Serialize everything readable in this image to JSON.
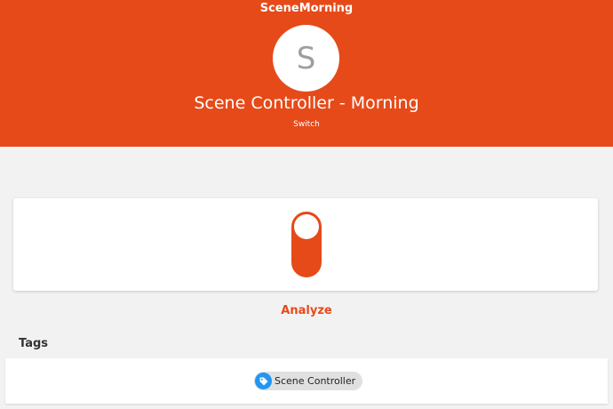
{
  "header": {
    "title": "SceneMorning",
    "avatar_letter": "S",
    "label": "Scene Controller - Morning",
    "type": "Switch",
    "color": "#e64a19"
  },
  "control": {
    "switch_state": "ON",
    "switch_color": "#e64a19"
  },
  "actions": {
    "analyze_label": "Analyze"
  },
  "tags": {
    "heading": "Tags",
    "items": [
      {
        "label": "Scene Controller",
        "icon": "tag-icon",
        "icon_color": "#2196f3"
      }
    ]
  }
}
